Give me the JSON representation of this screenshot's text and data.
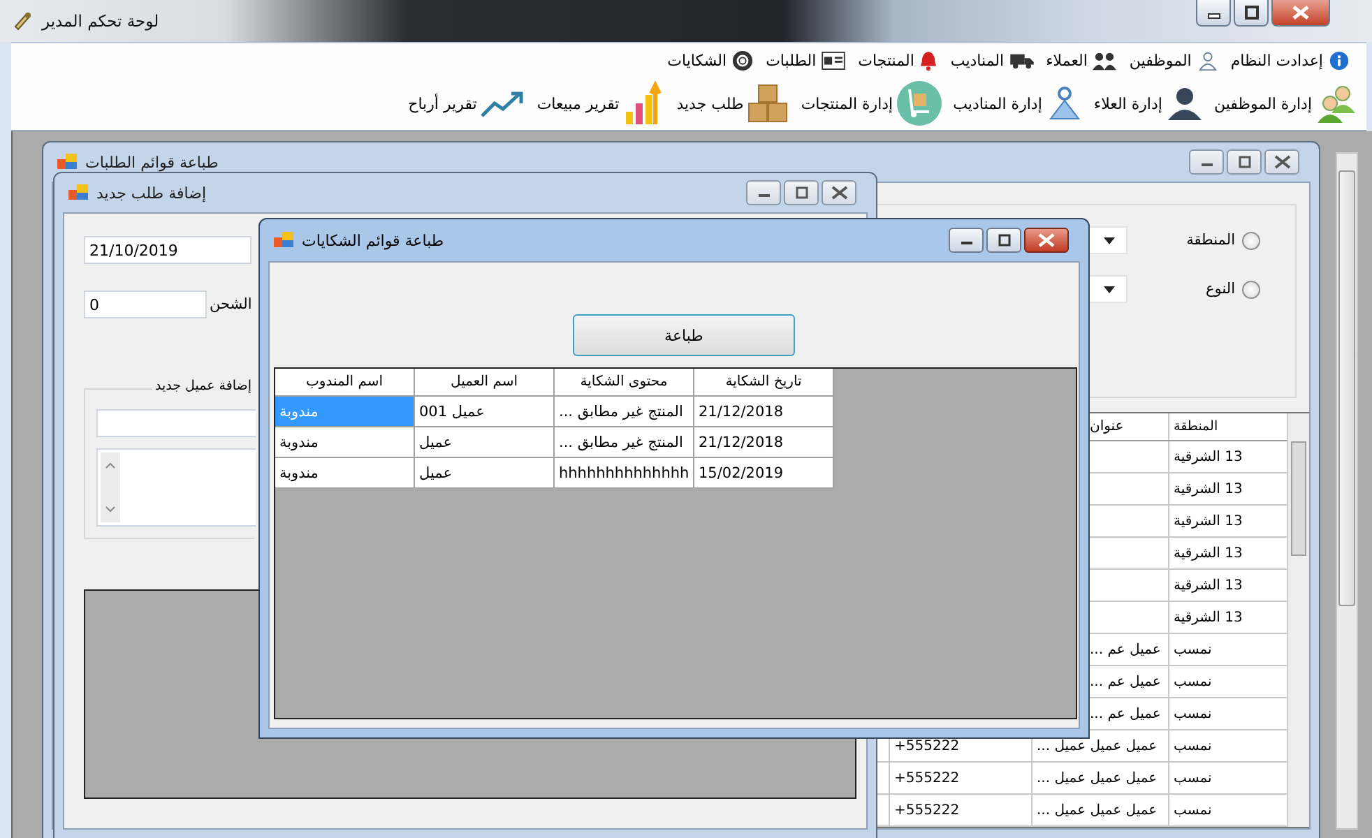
{
  "window": {
    "title": "لوحة تحكم المدير"
  },
  "menu": [
    {
      "label": "إعدادت النظام",
      "kind": "info"
    },
    {
      "label": "الموظفين",
      "kind": "user"
    },
    {
      "label": "العملاء",
      "kind": "users"
    },
    {
      "label": "المناديب",
      "kind": "truck"
    },
    {
      "label": "المنتجات",
      "kind": "bell"
    },
    {
      "label": "الطلبات",
      "kind": "card"
    },
    {
      "label": "الشكايات",
      "kind": "lifebuoy"
    }
  ],
  "toolbar": [
    {
      "label": "إدارة الموظفين",
      "kind": "staff"
    },
    {
      "label": "إدارة العلاء",
      "kind": "customers"
    },
    {
      "label": "إدارة المناديب",
      "kind": "x"
    },
    {
      "label": "إدارة المنتجات",
      "kind": "dolly"
    },
    {
      "label": "طلب جديد",
      "kind": "boxes"
    },
    {
      "label": "تقرير مبيعات",
      "kind": "bars"
    },
    {
      "label": "تقرير أرباح",
      "kind": "trend"
    }
  ],
  "orders_print_window": {
    "title": "طباعة قوائم الطلبات",
    "filters": [
      {
        "label": "المنطقة",
        "selected": false
      },
      {
        "label": "النوع",
        "selected": false
      }
    ],
    "table": {
      "columns": [
        "المنطقة",
        "عنوان"
      ],
      "rows": [
        {
          "region": "13 الشرقية"
        },
        {
          "region": "13 الشرقية"
        },
        {
          "region": "13 الشرقية"
        },
        {
          "region": "13 الشرقية"
        },
        {
          "region": "13 الشرقية"
        },
        {
          "region": "13 الشرقية"
        },
        {
          "region": "نمسب",
          "address": "... عميل عم"
        },
        {
          "region": "نمسب",
          "address": "... عميل عم"
        },
        {
          "region": "نمسب",
          "address": "... عميل عم"
        },
        {
          "region": "نمسب",
          "address": "... عميل عميل عميل",
          "phone": "+555222"
        },
        {
          "region": "نمسب",
          "address": "... عميل عميل عميل",
          "phone": "+555222"
        },
        {
          "region": "نمسب",
          "address": "... عميل عميل عميل",
          "phone": "+555222"
        }
      ]
    }
  },
  "new_order_window": {
    "title": "إضافة طلب جديد",
    "date": "21/10/2019",
    "shipping": {
      "label": "الشحن",
      "value": "0"
    },
    "new_customer_group": "إضافة عميل جديد"
  },
  "complaints_window": {
    "title": "طباعة قوائم الشكايات",
    "print_button": "طباعة",
    "table": {
      "columns": [
        "تاريخ الشكاية",
        "محتوى الشكاية",
        "اسم العميل",
        "اسم المندوب"
      ],
      "rows": [
        {
          "date": "21/12/2018",
          "content": "... المنتج غير مطابق",
          "customer": "عميل 001",
          "delegate": "مندوبة",
          "selected": true
        },
        {
          "date": "21/12/2018",
          "content": "... المنتج غير مطابق",
          "customer": "عميل",
          "delegate": "مندوبة",
          "selected": false
        },
        {
          "date": "15/02/2019",
          "content": "hhhhhhhhhhhhhh",
          "customer": "عميل",
          "delegate": "مندوبة",
          "selected": false
        }
      ]
    }
  }
}
